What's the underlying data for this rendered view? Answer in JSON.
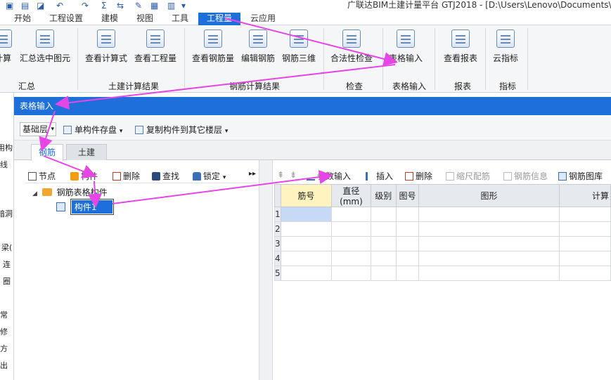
{
  "window": {
    "title": "广联达BIM土建计量平台 GTJ2018 - [D:\\Users\\Lenovo\\Documents\\"
  },
  "ribbon_tabs": [
    {
      "label": "开始"
    },
    {
      "label": "工程设置"
    },
    {
      "label": "建模"
    },
    {
      "label": "视图"
    },
    {
      "label": "工具"
    },
    {
      "label": "工程量"
    },
    {
      "label": "云应用"
    }
  ],
  "ribbon": {
    "buttons": {
      "calc": "计算",
      "summary_selected": "汇总选中图元",
      "view_formula": "查看计算式",
      "view_quantity": "查看工程量",
      "view_rebar_qty": "查看钢筋量",
      "edit_rebar": "编辑钢筋",
      "rebar_3d": "钢筋三维",
      "validity_check": "合法性检查",
      "table_input": "表格输入",
      "view_report": "查看报表",
      "cloud_index": "云指标"
    },
    "groups": {
      "summary": "汇总",
      "civil_results": "土建计算结果",
      "rebar_results": "钢筋计算结果",
      "check": "检查",
      "table_input": "表格输入",
      "report": "报表",
      "index": "指标"
    }
  },
  "left_strip": [
    "用构",
    "线",
    "",
    "暗洞",
    "梁(",
    "连",
    "圈",
    "",
    "常",
    "修",
    "方",
    "出"
  ],
  "panel": {
    "title": "表格输入",
    "floor_combo": "基础层",
    "save_single": "单构件存盘",
    "copy_to_floors": "复制构件到其它楼层",
    "tab_rebar": "钢筋",
    "tab_civil": "土建"
  },
  "left_toolbar": {
    "node": "节点",
    "component": "构件",
    "delete": "删除",
    "find": "查找",
    "lock": "锁定"
  },
  "tree": {
    "root": "钢筋表格构件",
    "child": "构件1"
  },
  "right_toolbar": {
    "param_input": "参数输入",
    "insert": "插入",
    "delete": "删除",
    "scale_rebar": "缩尺配筋",
    "rebar_info": "钢筋信息",
    "rebar_library": "钢筋图库"
  },
  "grid": {
    "columns": [
      "筋号",
      "直径(mm)",
      "级别",
      "图号",
      "图形",
      "计算"
    ],
    "rows": [
      "1",
      "2",
      "3",
      "4",
      "5"
    ]
  },
  "colors": {
    "accent": "#1e6fd9",
    "arrow": "#e646e6"
  }
}
